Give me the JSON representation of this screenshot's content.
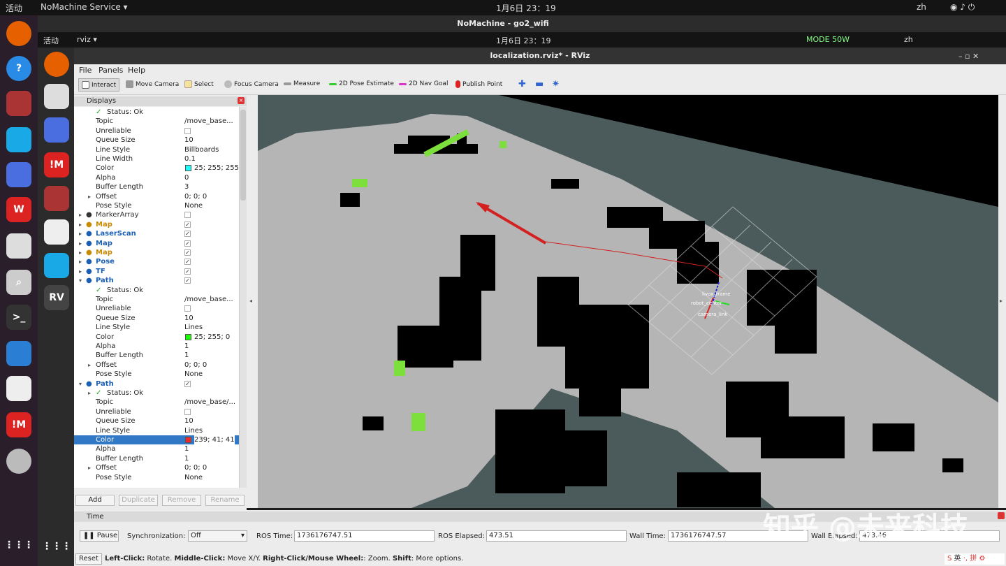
{
  "outer_topbar": {
    "activities": "活动",
    "app": "NoMachine Service",
    "clock": "1月6日  23：19",
    "lang": "zh"
  },
  "nomachine_title": "NoMachine - go2_wifi",
  "inner_topbar": {
    "activities": "活动",
    "app": "rviz",
    "clock": "1月6日  23：19",
    "mode": "MODE 50W",
    "lang": "zh"
  },
  "window_title": "localization.rviz* - RViz",
  "menu": [
    "File",
    "Panels",
    "Help"
  ],
  "toolbar": [
    {
      "label": "Interact",
      "icon": "hand-icon"
    },
    {
      "label": "Move Camera",
      "icon": "move-camera-icon"
    },
    {
      "label": "Select",
      "icon": "select-icon"
    },
    {
      "label": "Focus Camera",
      "icon": "focus-icon"
    },
    {
      "label": "Measure",
      "icon": "ruler-icon"
    },
    {
      "label": "2D Pose Estimate",
      "icon": "green-arrow-icon"
    },
    {
      "label": "2D Nav Goal",
      "icon": "pink-arrow-icon"
    },
    {
      "label": "Publish Point",
      "icon": "pin-icon"
    }
  ],
  "panel_title": "Displays",
  "rows": [
    {
      "k": "Status: Ok",
      "v": "",
      "t": "status"
    },
    {
      "k": "Topic",
      "v": "/move_base..."
    },
    {
      "k": "Unreliable",
      "v": "",
      "t": "cb0"
    },
    {
      "k": "Queue Size",
      "v": "10"
    },
    {
      "k": "Line Style",
      "v": "Billboards"
    },
    {
      "k": "Line Width",
      "v": "0.1"
    },
    {
      "k": "Color",
      "v": "25; 255; 255",
      "t": "color",
      "c": "#19ffff"
    },
    {
      "k": "Alpha",
      "v": "0"
    },
    {
      "k": "Buffer Length",
      "v": "3"
    },
    {
      "k": "Offset",
      "v": "0; 0; 0",
      "t": "sub"
    },
    {
      "k": "Pose Style",
      "v": "None"
    },
    {
      "k": "MarkerArray",
      "v": "",
      "t": "top0",
      "c": "#333"
    },
    {
      "k": "Map",
      "v": "",
      "t": "top1",
      "c": "#c98a00"
    },
    {
      "k": "LaserScan",
      "v": "",
      "t": "top1",
      "c": "#1a5fb4"
    },
    {
      "k": "Map",
      "v": "",
      "t": "top1",
      "c": "#1a5fb4"
    },
    {
      "k": "Map",
      "v": "",
      "t": "top1",
      "c": "#c98a00"
    },
    {
      "k": "Pose",
      "v": "",
      "t": "top1",
      "c": "#1a5fb4"
    },
    {
      "k": "TF",
      "v": "",
      "t": "top1",
      "c": "#1a5fb4"
    },
    {
      "k": "Path",
      "v": "",
      "t": "topo",
      "c": "#1a5fb4"
    },
    {
      "k": "Status: Ok",
      "v": "",
      "t": "status"
    },
    {
      "k": "Topic",
      "v": "/move_base..."
    },
    {
      "k": "Unreliable",
      "v": "",
      "t": "cb0"
    },
    {
      "k": "Queue Size",
      "v": "10"
    },
    {
      "k": "Line Style",
      "v": "Lines"
    },
    {
      "k": "Color",
      "v": "25; 255; 0",
      "t": "color",
      "c": "#19ff00"
    },
    {
      "k": "Alpha",
      "v": "1"
    },
    {
      "k": "Buffer Length",
      "v": "1"
    },
    {
      "k": "Offset",
      "v": "0; 0; 0",
      "t": "sub"
    },
    {
      "k": "Pose Style",
      "v": "None"
    },
    {
      "k": "Path",
      "v": "",
      "t": "topo",
      "c": "#1a5fb4"
    },
    {
      "k": "Status: Ok",
      "v": "",
      "t": "status2"
    },
    {
      "k": "Topic",
      "v": "/move_base/..."
    },
    {
      "k": "Unreliable",
      "v": "",
      "t": "cb0"
    },
    {
      "k": "Queue Size",
      "v": "10"
    },
    {
      "k": "Line Style",
      "v": "Lines"
    },
    {
      "k": "Color",
      "v": "239; 41; 41",
      "t": "colorsel",
      "c": "#ef2929"
    },
    {
      "k": "Alpha",
      "v": "1"
    },
    {
      "k": "Buffer Length",
      "v": "1"
    },
    {
      "k": "Offset",
      "v": "0; 0; 0",
      "t": "sub"
    },
    {
      "k": "Pose Style",
      "v": "None"
    }
  ],
  "panel_buttons": [
    "Add",
    "Duplicate",
    "Remove",
    "Rename"
  ],
  "time_panel": {
    "title": "Time",
    "pause": "Pause",
    "sync_label": "Synchronization:",
    "sync_value": "Off",
    "ros_time_label": "ROS Time:",
    "ros_time": "1736176747.51",
    "ros_elapsed_label": "ROS Elapsed:",
    "ros_elapsed": "473.51",
    "wall_time_label": "Wall Time:",
    "wall_time": "1736176747.57",
    "wall_elapsed_label": "Wall Elapsed:",
    "wall_elapsed": "473.46",
    "reset": "Reset"
  },
  "status_hint": {
    "b1": "Left-Click:",
    "t1": " Rotate. ",
    "b2": "Middle-Click:",
    "t2": " Move X/Y. ",
    "b3": "Right-Click/Mouse Wheel:",
    "t3": ": Zoom. ",
    "b4": "Shift",
    "t4": ": More options."
  },
  "watermark": "知乎 @未来科技",
  "tf_labels": [
    "livox_frame",
    "robot_center",
    "camera_link"
  ],
  "ime": "英"
}
